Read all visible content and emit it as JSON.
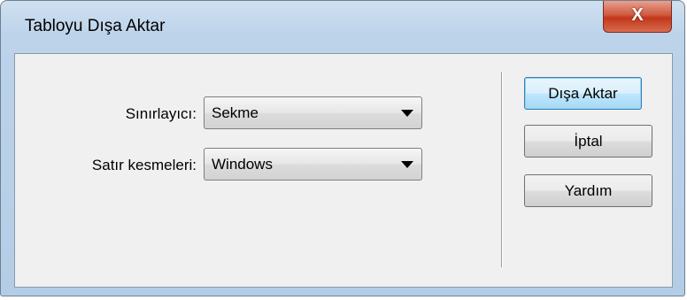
{
  "window": {
    "title": "Tabloyu Dışa Aktar",
    "close_glyph": "X"
  },
  "form": {
    "delimiter_label": "Sınırlayıcı:",
    "delimiter_value": "Sekme",
    "linebreak_label": "Satır kesmeleri:",
    "linebreak_value": "Windows"
  },
  "buttons": {
    "export": "Dışa Aktar",
    "cancel": "İptal",
    "help": "Yardım"
  },
  "icons": {
    "close": "close-icon",
    "dropdown": "chevron-down-icon"
  },
  "colors": {
    "close_button": "#c2371b",
    "default_button_border": "#3c7fb1",
    "frame": "#bcd3ea"
  }
}
